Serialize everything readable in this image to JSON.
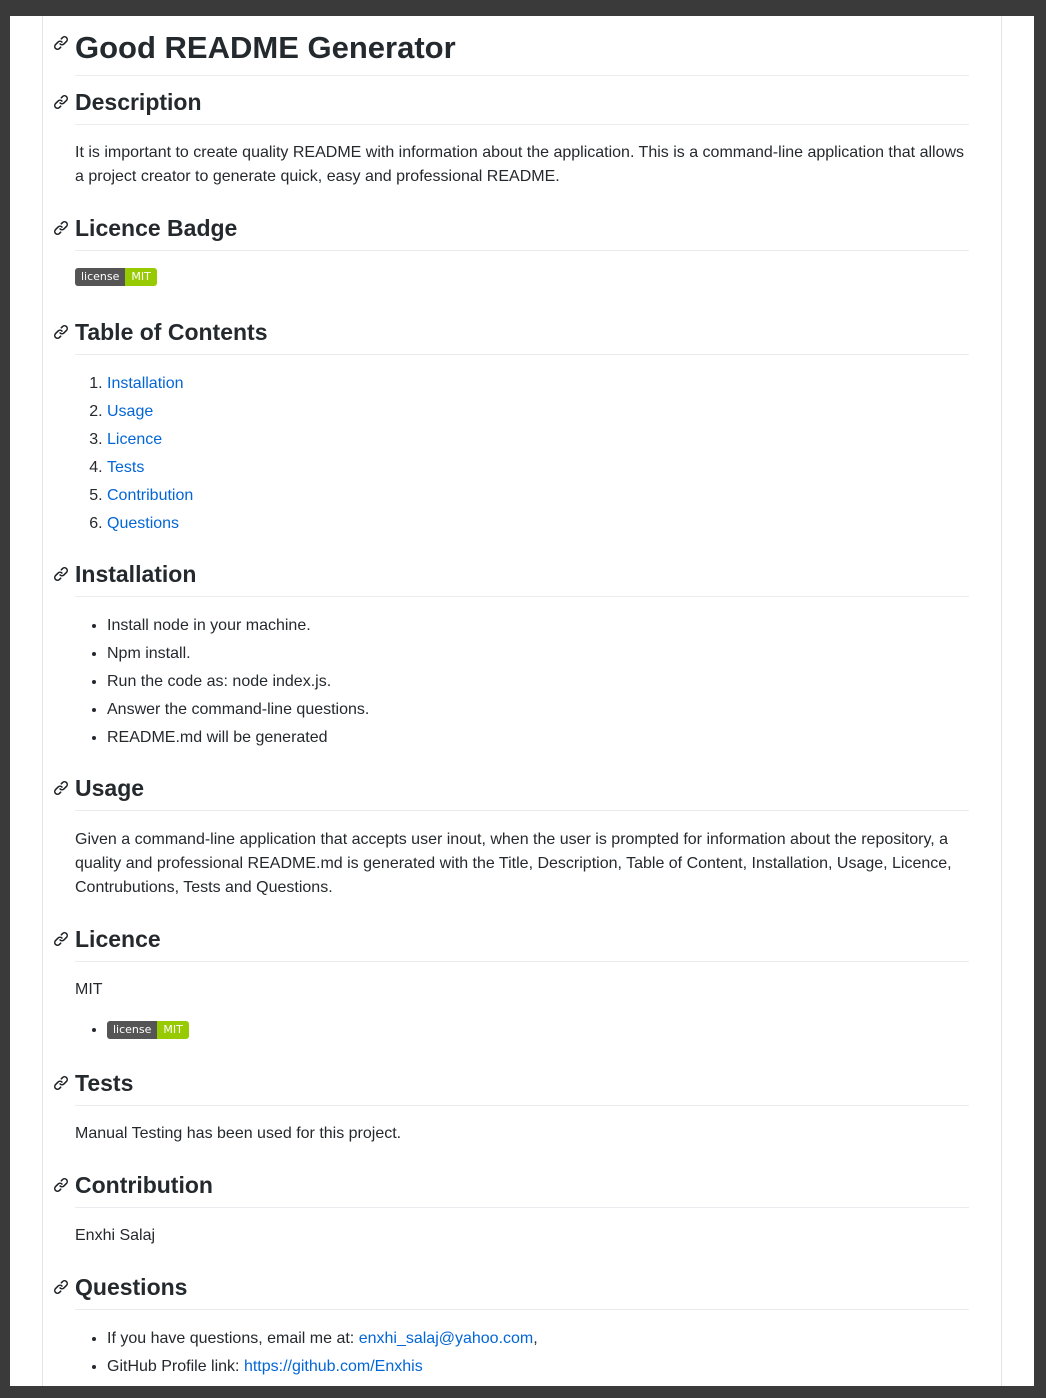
{
  "title": "Good README Generator",
  "sections": {
    "description": {
      "heading": "Description",
      "text": "It is important to create quality README with information about the application. This is a command-line application that allows a project creator to generate quick, easy and professional README."
    },
    "licence_badge": {
      "heading": "Licence Badge",
      "badge_left": "license",
      "badge_right": "MIT"
    },
    "toc": {
      "heading": "Table of Contents",
      "items": [
        "Installation",
        "Usage",
        "Licence",
        "Tests",
        "Contribution",
        "Questions"
      ]
    },
    "installation": {
      "heading": "Installation",
      "items": [
        "Install node in your machine.",
        "Npm install.",
        "Run the code as: node index.js.",
        "Answer the command-line questions.",
        "README.md will be generated"
      ]
    },
    "usage": {
      "heading": "Usage",
      "text": "Given a command-line application that accepts user inout, when the user is prompted for information about the repository, a quality and professional README.md is generated with the Title, Description, Table of Content, Installation, Usage, Licence, Contrubutions, Tests and Questions."
    },
    "licence": {
      "heading": "Licence",
      "text": "MIT",
      "badge_left": "license",
      "badge_right": "MIT"
    },
    "tests": {
      "heading": "Tests",
      "text": "Manual Testing has been used for this project."
    },
    "contribution": {
      "heading": "Contribution",
      "text": "Enxhi Salaj"
    },
    "questions": {
      "heading": "Questions",
      "email_prefix": "If you have questions, email me at: ",
      "email": "enxhi_salaj@yahoo.com",
      "email_suffix": ",",
      "github_prefix": "GitHub Profile link: ",
      "github": "https://github.com/Enxhis"
    }
  },
  "colors": {
    "link": "#0366d6",
    "badge_left": "#555555",
    "badge_right": "#97ca00"
  },
  "icons": {
    "heading_anchor": "link-icon"
  }
}
